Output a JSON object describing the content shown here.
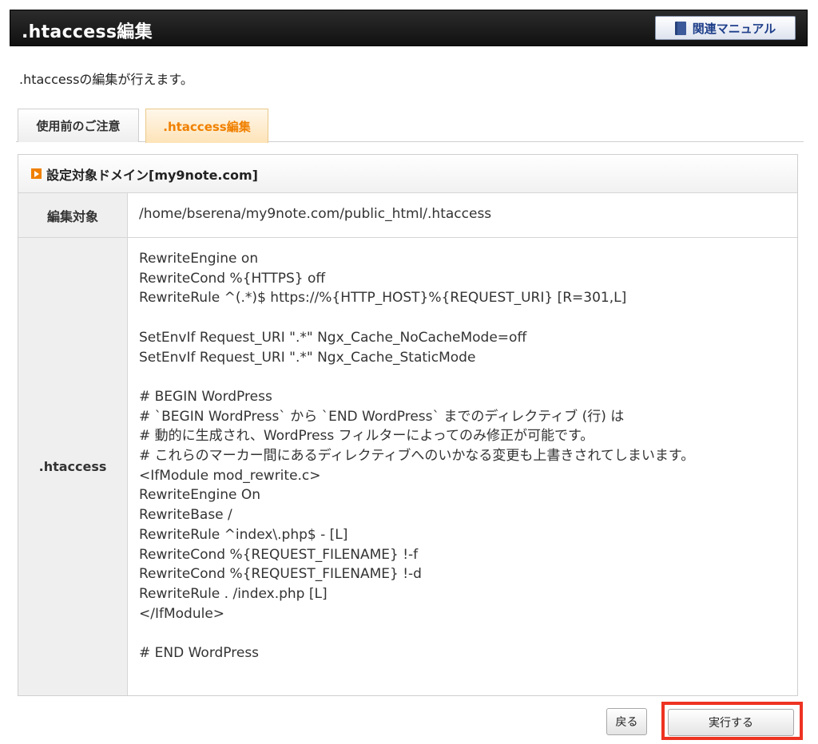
{
  "header": {
    "title": ".htaccess編集",
    "manual_label": "関連マニュアル"
  },
  "intro": ".htaccessの編集が行えます。",
  "tabs": [
    {
      "label": "使用前のご注意",
      "active": false
    },
    {
      "label": ".htaccess編集",
      "active": true
    }
  ],
  "panel": {
    "heading": "設定対象ドメイン[my9note.com]",
    "target_label": "編集対象",
    "target_path": "/home/bserena/my9note.com/public_html/.htaccess",
    "htaccess_label": ".htaccess",
    "htaccess_content": "RewriteEngine on\nRewriteCond %{HTTPS} off\nRewriteRule ^(.*)$ https://%{HTTP_HOST}%{REQUEST_URI} [R=301,L]\n\nSetEnvIf Request_URI \".*\" Ngx_Cache_NoCacheMode=off\nSetEnvIf Request_URI \".*\" Ngx_Cache_StaticMode\n\n# BEGIN WordPress\n# `BEGIN WordPress` から `END WordPress` までのディレクティブ (行) は\n# 動的に生成され、WordPress フィルターによってのみ修正が可能です。\n# これらのマーカー間にあるディレクティブへのいかなる変更も上書きされてしまいます。\n<IfModule mod_rewrite.c>\nRewriteEngine On\nRewriteBase /\nRewriteRule ^index\\.php$ - [L]\nRewriteCond %{REQUEST_FILENAME} !-f\nRewriteCond %{REQUEST_FILENAME} !-d\nRewriteRule . /index.php [L]\n</IfModule>\n\n# END WordPress"
  },
  "buttons": {
    "back": "戻る",
    "execute": "実行する"
  },
  "colors": {
    "tab_active_text": "#f08000",
    "highlight_border": "#ee3322"
  }
}
